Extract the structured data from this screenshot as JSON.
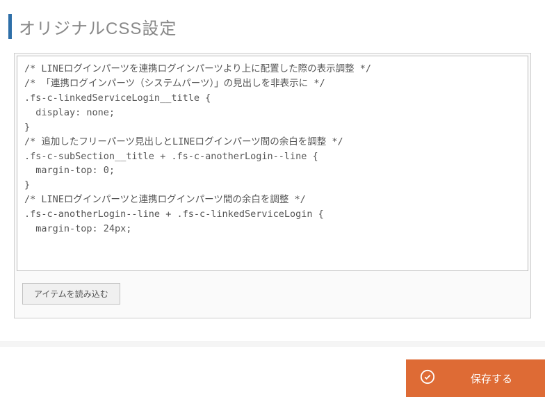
{
  "header": {
    "title": "オリジナルCSS設定"
  },
  "editor": {
    "css_content": "/* LINEログインパーツを連携ログインパーツより上に配置した際の表示調整 */\n/* 「連携ログインパーツ（システムパーツ）」の見出しを非表示に */\n.fs-c-linkedServiceLogin__title {\n  display: none;\n}\n/* 追加したフリーパーツ見出しとLINEログインパーツ間の余白を調整 */\n.fs-c-subSection__title + .fs-c-anotherLogin--line {\n  margin-top: 0;\n}\n/* LINEログインパーツと連携ログインパーツ間の余白を調整 */\n.fs-c-anotherLogin--line + .fs-c-linkedServiceLogin {\n  margin-top: 24px;"
  },
  "buttons": {
    "load_item": "アイテムを読み込む",
    "save": "保存する"
  },
  "colors": {
    "accent_blue": "#2e6fa8",
    "action_orange": "#de6b35"
  }
}
